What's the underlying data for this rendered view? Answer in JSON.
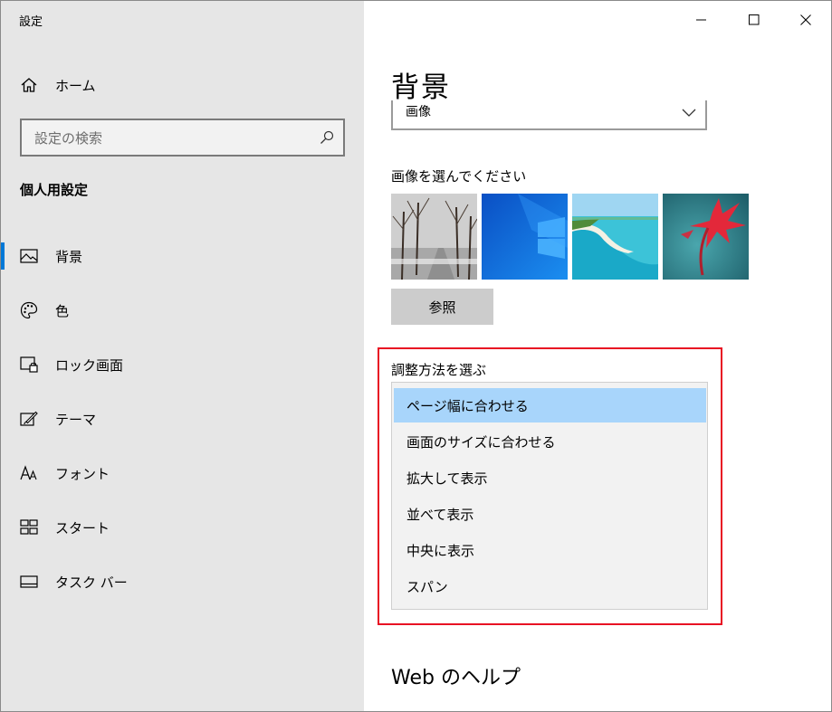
{
  "window": {
    "title": "設定"
  },
  "sidebar": {
    "home_label": "ホーム",
    "search_placeholder": "設定の検索",
    "section_heading": "個人用設定",
    "items": [
      {
        "label": "背景",
        "icon": "picture-icon",
        "active": true
      },
      {
        "label": "色",
        "icon": "palette-icon",
        "active": false
      },
      {
        "label": "ロック画面",
        "icon": "lock-screen-icon",
        "active": false
      },
      {
        "label": "テーマ",
        "icon": "theme-brush-icon",
        "active": false
      },
      {
        "label": "フォント",
        "icon": "font-icon",
        "active": false
      },
      {
        "label": "スタート",
        "icon": "start-icon",
        "active": false
      },
      {
        "label": "タスク バー",
        "icon": "taskbar-icon",
        "active": false
      }
    ]
  },
  "main": {
    "page_title": "背景",
    "background_type_value": "画像",
    "choose_image_label": "画像を選んでください",
    "browse_label": "参照",
    "fit_label": "調整方法を選ぶ",
    "fit_options": [
      {
        "label": "ページ幅に合わせる",
        "selected": true
      },
      {
        "label": "画面のサイズに合わせる",
        "selected": false
      },
      {
        "label": "拡大して表示",
        "selected": false
      },
      {
        "label": "並べて表示",
        "selected": false
      },
      {
        "label": "中央に表示",
        "selected": false
      },
      {
        "label": "スパン",
        "selected": false
      }
    ],
    "web_help_heading": "Web のヘルプ"
  },
  "colors": {
    "accent": "#0078d7",
    "highlight_border": "#e81123",
    "selected_option": "#a8d5fb",
    "sidebar_bg": "#e6e6e6"
  }
}
